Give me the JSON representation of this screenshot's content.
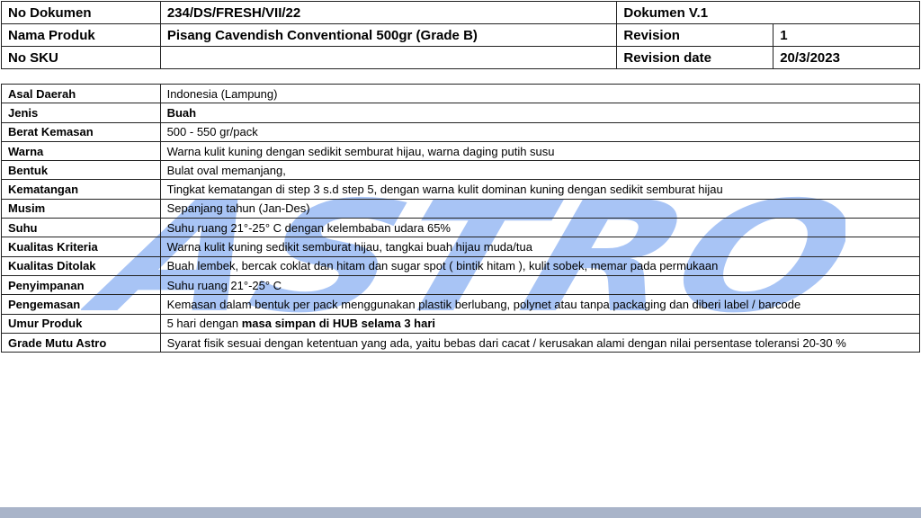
{
  "header": {
    "doc_no_label": "No Dokumen",
    "doc_no_value": "234/DS/FRESH/VII/22",
    "doc_version": "Dokumen V.1",
    "product_label": "Nama Produk",
    "product_value": "Pisang Cavendish Conventional 500gr (Grade B)",
    "revision_label": "Revision",
    "revision_value": "1",
    "sku_label": "No SKU",
    "sku_value": "",
    "revision_date_label": "Revision date",
    "revision_date_value": "20/3/2023"
  },
  "spec": [
    {
      "label": "Asal Daerah",
      "value": "Indonesia (Lampung)"
    },
    {
      "label": "Jenis",
      "value": "Buah"
    },
    {
      "label": "Berat Kemasan",
      "value": "500 - 550 gr/pack"
    },
    {
      "label": "Warna",
      "value": "Warna kulit kuning dengan sedikit semburat hijau, warna daging putih susu"
    },
    {
      "label": "Bentuk",
      "value": "Bulat oval memanjang,"
    },
    {
      "label": "Kematangan",
      "value": "Tingkat kematangan di step 3 s.d  step 5, dengan warna kulit dominan kuning dengan sedikit semburat hijau"
    },
    {
      "label": "Musim",
      "value": "Sepanjang tahun (Jan-Des)"
    },
    {
      "label": "Suhu",
      "value": "Suhu ruang  21°-25° C dengan kelembaban udara 65%"
    },
    {
      "label": "Kualitas Kriteria",
      "value": "Warna kulit kuning sedikit semburat hijau, tangkai buah hijau muda/tua"
    },
    {
      "label": "Kualitas Ditolak",
      "value": "Buah lembek, bercak coklat dan hitam dan sugar spot ( bintik hitam ), kulit sobek, memar pada permukaan"
    },
    {
      "label": "Penyimpanan",
      "value": "Suhu ruang 21°-25° C"
    },
    {
      "label": "Pengemasan",
      "value": "Kemasan dalam bentuk per pack menggunakan plastik berlubang, polynet atau tanpa packaging dan diberi label / barcode"
    },
    {
      "label": "Umur Produk",
      "value_plain": "5 hari dengan ",
      "value_bold": "masa simpan di HUB selama 3 hari"
    },
    {
      "label": "Grade Mutu Astro",
      "value": "Syarat fisik sesuai dengan ketentuan yang ada, yaitu bebas dari cacat / kerusakan alami dengan  nilai persentase toleransi 20-30 %"
    }
  ],
  "watermark": {
    "text": "ASTRO",
    "color": "#6f9ef0"
  },
  "colors": {
    "bottom_bar": "#a9b4c9",
    "border": "#222222"
  }
}
